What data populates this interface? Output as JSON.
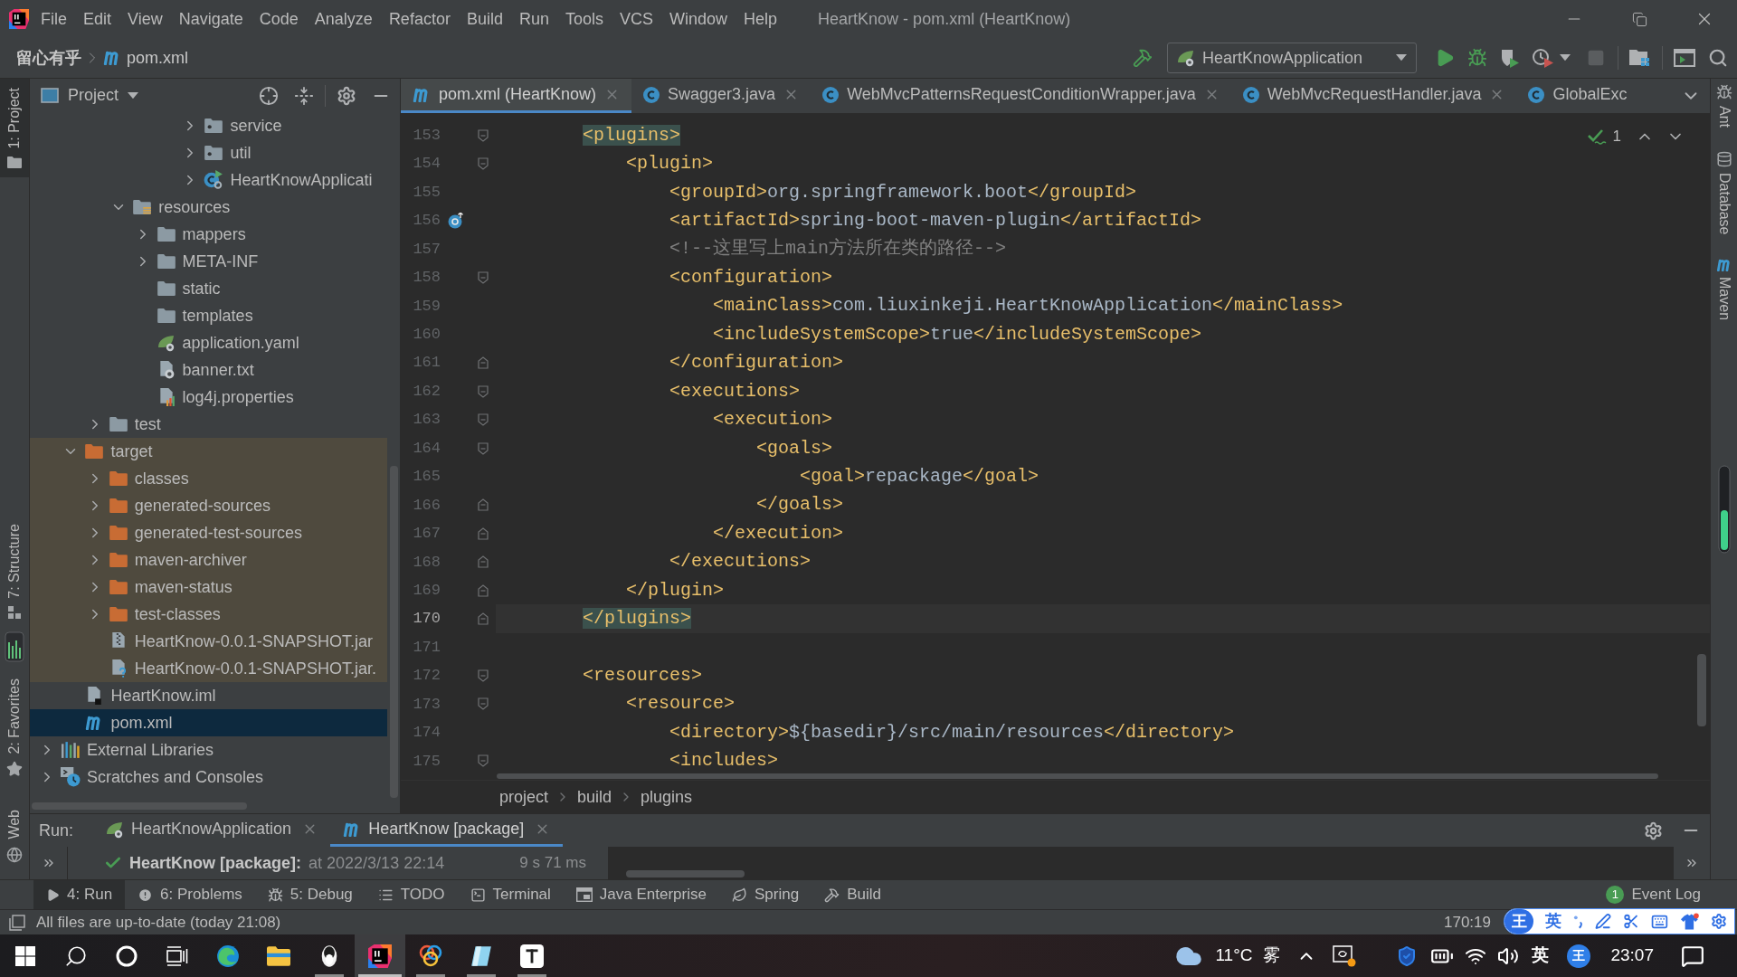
{
  "window": {
    "title": "HeartKnow - pom.xml (HeartKnow)"
  },
  "menu": [
    "File",
    "Edit",
    "View",
    "Navigate",
    "Code",
    "Analyze",
    "Refactor",
    "Build",
    "Run",
    "Tools",
    "VCS",
    "Window",
    "Help"
  ],
  "navigation_bar": {
    "breadcrumbs": [
      {
        "label": "留心有乎",
        "kind": "project"
      },
      {
        "label": "pom.xml",
        "kind": "maven"
      }
    ],
    "run_configuration": "HeartKnowApplication",
    "stop": {
      "disabled": true
    }
  },
  "left_stripe": [
    {
      "label": "1: Project",
      "kind": "project",
      "selected": true
    },
    {
      "label": "7: Structure",
      "kind": "structure",
      "selected": false
    },
    {
      "label": "2: Favorites",
      "kind": "favorites",
      "selected": false
    },
    {
      "label": "Web",
      "kind": "web",
      "selected": false
    }
  ],
  "right_stripe": [
    {
      "label": "Ant",
      "kind": "ant"
    },
    {
      "label": "Database",
      "kind": "database"
    },
    {
      "label": "Maven",
      "kind": "maven"
    }
  ],
  "project_panel": {
    "title": "Project",
    "tree": [
      {
        "children": [
          {
            "children": [
              {
                "children": [
                  {
                    "children": [
                      {
                        "children": [
                          {
                            "children": [
                              {
                                "label": "service",
                                "kind": "package",
                                "expanded": false,
                                "selected": false
                              },
                              {
                                "label": "util",
                                "kind": "package",
                                "expanded": false,
                                "selected": false
                              },
                              {
                                "label": "HeartKnowApplicati",
                                "kind": "spring-class",
                                "expanded": false,
                                "selected": false
                              }
                            ]
                          }
                        ]
                      }
                    ]
                  },
                  {
                    "label": "resources",
                    "kind": "resources",
                    "expanded": true,
                    "selected": false,
                    "children": [
                      {
                        "label": "mappers",
                        "kind": "folder",
                        "expanded": false,
                        "selected": false
                      },
                      {
                        "label": "META-INF",
                        "kind": "folder",
                        "expanded": false,
                        "selected": false
                      },
                      {
                        "label": "static",
                        "kind": "folder",
                        "selected": false
                      },
                      {
                        "label": "templates",
                        "kind": "folder",
                        "selected": false
                      },
                      {
                        "label": "application.yaml",
                        "kind": "spring-config",
                        "selected": false
                      },
                      {
                        "label": "banner.txt",
                        "kind": "text",
                        "selected": false
                      },
                      {
                        "label": "log4j.properties",
                        "kind": "properties",
                        "selected": false
                      }
                    ]
                  }
                ]
              },
              {
                "label": "test",
                "kind": "folder",
                "expanded": false,
                "selected": false
              }
            ]
          },
          {
            "label": "target",
            "kind": "excluded",
            "expanded": true,
            "selected": false,
            "children": [
              {
                "label": "classes",
                "kind": "excluded",
                "expanded": false,
                "selected": false
              },
              {
                "label": "generated-sources",
                "kind": "excluded",
                "expanded": false,
                "selected": false
              },
              {
                "label": "generated-test-sources",
                "kind": "excluded",
                "expanded": false,
                "selected": false
              },
              {
                "label": "maven-archiver",
                "kind": "excluded",
                "expanded": false,
                "selected": false
              },
              {
                "label": "maven-status",
                "kind": "excluded",
                "expanded": false,
                "selected": false
              },
              {
                "label": "test-classes",
                "kind": "excluded",
                "expanded": false,
                "selected": false
              },
              {
                "label": "HeartKnow-0.0.1-SNAPSHOT.jar",
                "kind": "archive",
                "selected": false
              },
              {
                "label": "HeartKnow-0.0.1-SNAPSHOT.jar.",
                "kind": "unknown",
                "selected": false
              }
            ]
          },
          {
            "label": "HeartKnow.iml",
            "kind": "module",
            "selected": false
          },
          {
            "label": "pom.xml",
            "kind": "maven",
            "selected": true
          }
        ]
      },
      {
        "label": "External Libraries",
        "kind": "libraries",
        "expanded": false,
        "selected": false
      },
      {
        "label": "Scratches and Consoles",
        "kind": "scratches",
        "expanded": false,
        "selected": false
      }
    ]
  },
  "editor": {
    "tabs": [
      {
        "label": "pom.xml (HeartKnow)",
        "kind": "maven",
        "selected": true,
        "closable": true
      },
      {
        "label": "Swagger3.java",
        "kind": "class",
        "selected": false,
        "closable": true
      },
      {
        "label": "WebMvcPatternsRequestConditionWrapper.java",
        "kind": "class",
        "selected": false,
        "closable": true
      },
      {
        "label": "WebMvcRequestHandler.java",
        "kind": "class",
        "selected": false,
        "closable": true
      },
      {
        "label": "GlobalExc",
        "kind": "class",
        "selected": false,
        "closable": false
      }
    ],
    "inspection_count": "1",
    "lines": [
      {
        "number": "153",
        "fold_start": true,
        "current": false,
        "segments": [
          {
            "kind": "match",
            "text": "        <plugins>"
          }
        ]
      },
      {
        "number": "154",
        "fold_start": true,
        "current": false,
        "segments": [
          {
            "kind": "tag",
            "text": "            <plugin>"
          }
        ]
      },
      {
        "number": "155",
        "current": false,
        "segments": [
          {
            "kind": "tag",
            "text": "                <groupId>"
          },
          {
            "kind": "text",
            "text": "org.springframework.boot"
          },
          {
            "kind": "tag",
            "text": "</groupId>"
          }
        ]
      },
      {
        "number": "156",
        "gutter_icon": true,
        "current": false,
        "segments": [
          {
            "kind": "tag",
            "text": "                <artifactId>"
          },
          {
            "kind": "text",
            "text": "spring-boot-maven-plugin"
          },
          {
            "kind": "tag",
            "text": "</artifactId>"
          }
        ]
      },
      {
        "number": "157",
        "current": false,
        "segments": [
          {
            "kind": "comment",
            "text": "                <!--这里写上main方法所在类的路径-->"
          }
        ]
      },
      {
        "number": "158",
        "fold_start": true,
        "current": false,
        "segments": [
          {
            "kind": "tag",
            "text": "                <configuration>"
          }
        ]
      },
      {
        "number": "159",
        "current": false,
        "segments": [
          {
            "kind": "tag",
            "text": "                    <mainClass>"
          },
          {
            "kind": "text",
            "text": "com.liuxinkeji.HeartKnowApplication"
          },
          {
            "kind": "tag",
            "text": "</mainClass>"
          }
        ]
      },
      {
        "number": "160",
        "current": false,
        "segments": [
          {
            "kind": "tag",
            "text": "                    <includeSystemScope>"
          },
          {
            "kind": "text",
            "text": "true"
          },
          {
            "kind": "tag",
            "text": "</includeSystemScope>"
          }
        ]
      },
      {
        "number": "161",
        "fold_end": true,
        "current": false,
        "segments": [
          {
            "kind": "tag",
            "text": "                </configuration>"
          }
        ]
      },
      {
        "number": "162",
        "fold_start": true,
        "current": false,
        "segments": [
          {
            "kind": "tag",
            "text": "                <executions>"
          }
        ]
      },
      {
        "number": "163",
        "fold_start": true,
        "current": false,
        "segments": [
          {
            "kind": "tag",
            "text": "                    <execution>"
          }
        ]
      },
      {
        "number": "164",
        "fold_start": true,
        "current": false,
        "segments": [
          {
            "kind": "tag",
            "text": "                        <goals>"
          }
        ]
      },
      {
        "number": "165",
        "current": false,
        "segments": [
          {
            "kind": "tag",
            "text": "                            <goal>"
          },
          {
            "kind": "text",
            "text": "repackage"
          },
          {
            "kind": "tag",
            "text": "</goal>"
          }
        ]
      },
      {
        "number": "166",
        "fold_end": true,
        "current": false,
        "segments": [
          {
            "kind": "tag",
            "text": "                        </goals>"
          }
        ]
      },
      {
        "number": "167",
        "fold_end": true,
        "current": false,
        "segments": [
          {
            "kind": "tag",
            "text": "                    </execution>"
          }
        ]
      },
      {
        "number": "168",
        "fold_end": true,
        "current": false,
        "segments": [
          {
            "kind": "tag",
            "text": "                </executions>"
          }
        ]
      },
      {
        "number": "169",
        "fold_end": true,
        "current": false,
        "segments": [
          {
            "kind": "tag",
            "text": "            </plugin>"
          }
        ]
      },
      {
        "number": "170",
        "fold_end": true,
        "current": true,
        "segments": [
          {
            "kind": "match",
            "text": "        </plugins>"
          }
        ]
      },
      {
        "number": "171",
        "current": false
      },
      {
        "number": "172",
        "fold_start": true,
        "current": false,
        "segments": [
          {
            "kind": "tag",
            "text": "        <resources>"
          }
        ]
      },
      {
        "number": "173",
        "fold_start": true,
        "current": false,
        "segments": [
          {
            "kind": "tag",
            "text": "            <resource>"
          }
        ]
      },
      {
        "number": "174",
        "current": false,
        "segments": [
          {
            "kind": "tag",
            "text": "                <directory>"
          },
          {
            "kind": "text",
            "text": "${basedir}/src/main/resources"
          },
          {
            "kind": "tag",
            "text": "</directory>"
          }
        ]
      },
      {
        "number": "175",
        "fold_start": true,
        "current": false,
        "segments": [
          {
            "kind": "tag",
            "text": "                <includes>"
          }
        ]
      }
    ],
    "breadcrumbs": [
      "project",
      "build",
      "plugins"
    ]
  },
  "run_panel": {
    "title": "Run:",
    "tabs": [
      {
        "label": "HeartKnowApplication",
        "kind": "spring",
        "selected": false
      },
      {
        "label": "HeartKnow [package]",
        "kind": "maven",
        "selected": true
      }
    ],
    "task": {
      "name": "HeartKnow [package]:",
      "detail": "at 2022/3/13 22:14",
      "duration": "9 s 71 ms",
      "succeeded": true
    }
  },
  "tool_buttons": [
    {
      "label": "4: Run",
      "kind": "run",
      "selected": true
    },
    {
      "label": "6: Problems",
      "kind": "problems",
      "selected": false
    },
    {
      "label": "5: Debug",
      "kind": "debug",
      "selected": false
    },
    {
      "label": "TODO",
      "kind": "todo",
      "selected": false
    },
    {
      "label": "Terminal",
      "kind": "terminal",
      "selected": false
    },
    {
      "label": "Java Enterprise",
      "kind": "enterprise",
      "selected": false
    },
    {
      "label": "Spring",
      "kind": "spring",
      "selected": false
    },
    {
      "label": "Build",
      "kind": "build",
      "selected": false
    }
  ],
  "event_log": {
    "count": "1",
    "label": "Event Log"
  },
  "status_bar": {
    "message": "All files are up-to-date (today 21:08)",
    "position": "170:19"
  },
  "ime_toolbar": {
    "logo": "王",
    "mode": "英"
  },
  "taskbar": {
    "apps": [
      {
        "kind": "browser",
        "running": false,
        "selected": false
      },
      {
        "kind": "files",
        "running": false,
        "selected": false
      },
      {
        "kind": "chat",
        "running": true,
        "selected": false
      },
      {
        "kind": "ide",
        "running": true,
        "selected": true
      },
      {
        "kind": "rings",
        "running": true,
        "selected": false
      },
      {
        "kind": "notes",
        "running": true,
        "selected": false
      },
      {
        "kind": "editor",
        "running": true,
        "selected": false
      }
    ],
    "weather": {
      "temperature": "11°C",
      "condition": "雾"
    },
    "input_mode": "英",
    "ime_logo": "王",
    "time": "23:07"
  }
}
